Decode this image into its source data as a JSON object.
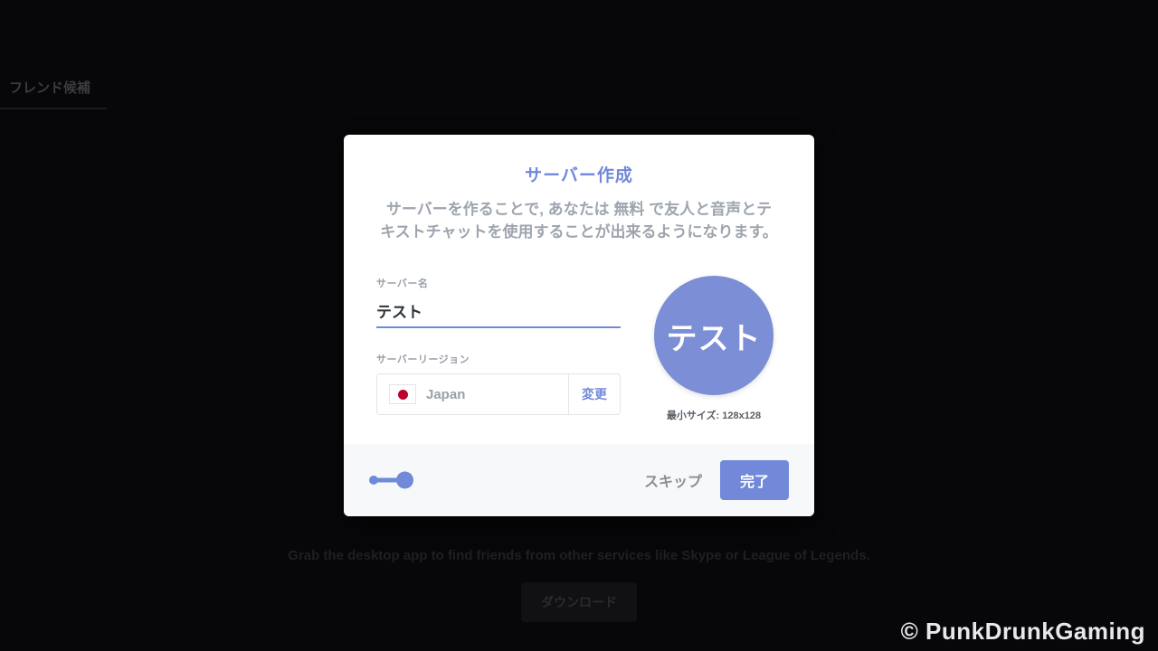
{
  "background": {
    "tab_label": "フレンド候補",
    "hint_text": "Grab the desktop app to find friends from other services like Skype or League of Legends.",
    "download_label": "ダウンロード"
  },
  "watermark": "© PunkDrunkGaming",
  "modal": {
    "title": "サーバー作成",
    "description_pre": "サーバーを作ることで, あなたは ",
    "description_bold": "無料",
    "description_post": " で友人と音声とテキストチャットを使用することが出来るようになります。",
    "server_name_label": "サーバー名",
    "server_name_value": "テスト",
    "server_region_label": "サーバーリージョン",
    "region_name": "Japan",
    "change_label": "変更",
    "avatar_text": "テスト",
    "avatar_hint": "最小サイズ: 128x128",
    "skip_label": "スキップ",
    "done_label": "完了"
  }
}
